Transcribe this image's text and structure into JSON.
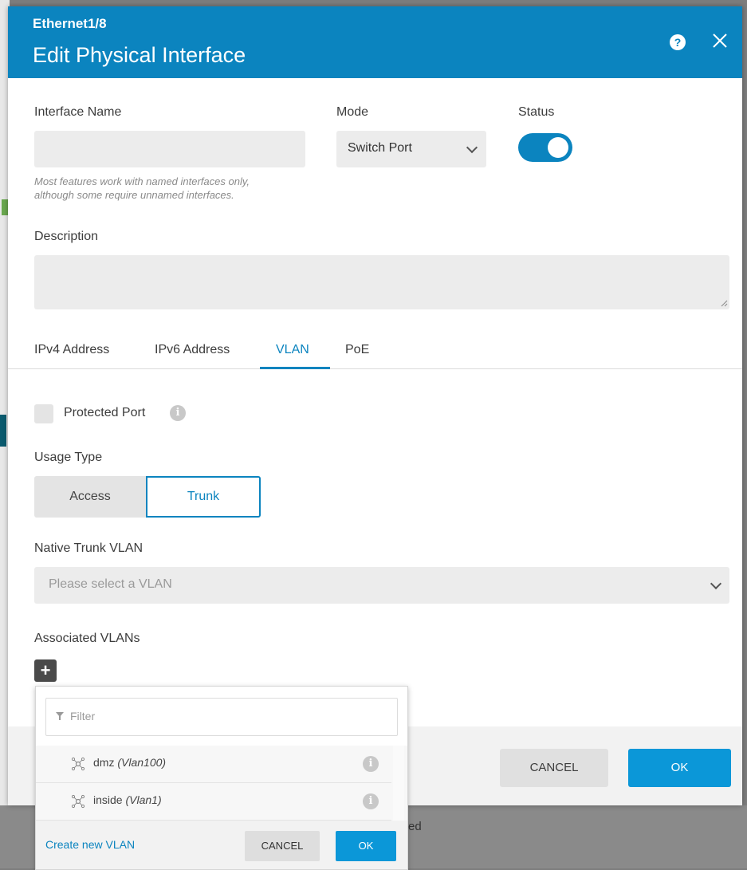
{
  "background": {
    "partial_text": "ed"
  },
  "header": {
    "subtitle": "Ethernet1/8",
    "title": "Edit Physical Interface",
    "help_icon": "?",
    "close_icon": "close"
  },
  "form": {
    "interface_name": {
      "label": "Interface Name",
      "value": "",
      "hint_line1": "Most features work with named interfaces only,",
      "hint_line2": "although some require unnamed interfaces."
    },
    "mode": {
      "label": "Mode",
      "value": "Switch Port"
    },
    "status": {
      "label": "Status",
      "enabled": true
    },
    "description": {
      "label": "Description",
      "value": ""
    }
  },
  "tabs": [
    {
      "label": "IPv4 Address",
      "active": false
    },
    {
      "label": "IPv6 Address",
      "active": false
    },
    {
      "label": "VLAN",
      "active": true
    },
    {
      "label": "PoE",
      "active": false
    }
  ],
  "vlan": {
    "protected_port": {
      "label": "Protected Port",
      "checked": false
    },
    "usage_type": {
      "label": "Usage Type",
      "options": [
        "Access",
        "Trunk"
      ],
      "selected": "Trunk"
    },
    "native_trunk_vlan": {
      "label": "Native Trunk VLAN",
      "placeholder": "Please select a VLAN"
    },
    "associated_vlans": {
      "label": "Associated VLANs",
      "add_symbol": "+"
    }
  },
  "footer": {
    "cancel_label": "CANCEL",
    "ok_label": "OK"
  },
  "dropdown": {
    "filter_placeholder": "Filter",
    "items": [
      {
        "name": "dmz",
        "detail": "(Vlan100)"
      },
      {
        "name": "inside",
        "detail": "(Vlan1)"
      }
    ],
    "create_link": "Create new VLAN",
    "cancel_label": "CANCEL",
    "ok_label": "OK"
  },
  "colors": {
    "primary": "#0b84bf",
    "button_blue": "#0b97d8"
  }
}
